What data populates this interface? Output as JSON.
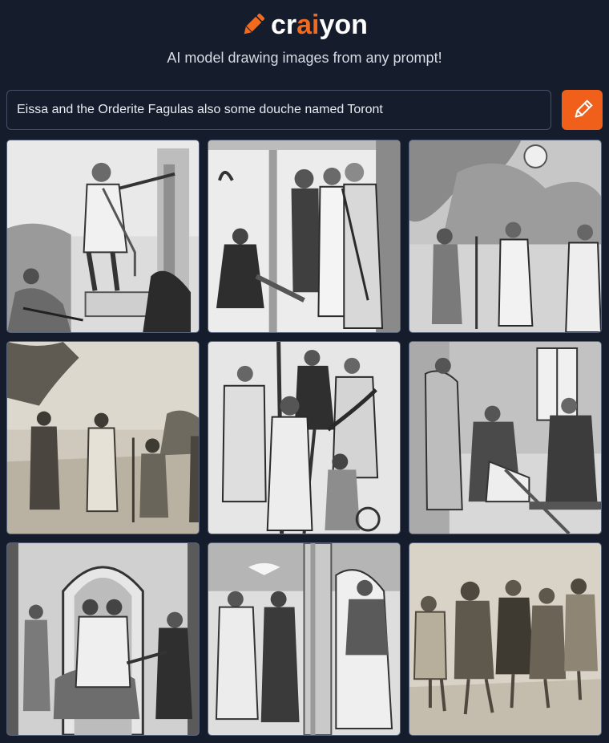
{
  "brand": {
    "name_start": "cr",
    "name_accent": "ai",
    "name_end": "yon",
    "accent_color": "#f26a1d",
    "icon": "pencil-icon"
  },
  "tagline": "AI model drawing images from any prompt!",
  "prompt": {
    "value": "Eissa and the Orderite Fagulas also some douche named Toront",
    "button_icon": "pencil-icon"
  },
  "images": [
    {
      "scene": "figure-on-pedestal",
      "tone": "grayscale-engraving"
    },
    {
      "scene": "group-under-doorway",
      "tone": "grayscale-engraving"
    },
    {
      "scene": "robed-figures-cloudy-sky",
      "tone": "grayscale-engraving"
    },
    {
      "scene": "cloaked-figures-in-field",
      "tone": "sepia-engraving"
    },
    {
      "scene": "crowd-with-staffs",
      "tone": "grayscale-engraving"
    },
    {
      "scene": "seated-figures-by-window",
      "tone": "grayscale-engraving"
    },
    {
      "scene": "figures-under-arch",
      "tone": "grayscale-engraving"
    },
    {
      "scene": "hooded-figures-by-pillar",
      "tone": "grayscale-engraving"
    },
    {
      "scene": "row-of-hunched-figures",
      "tone": "sepia-engraving"
    }
  ]
}
